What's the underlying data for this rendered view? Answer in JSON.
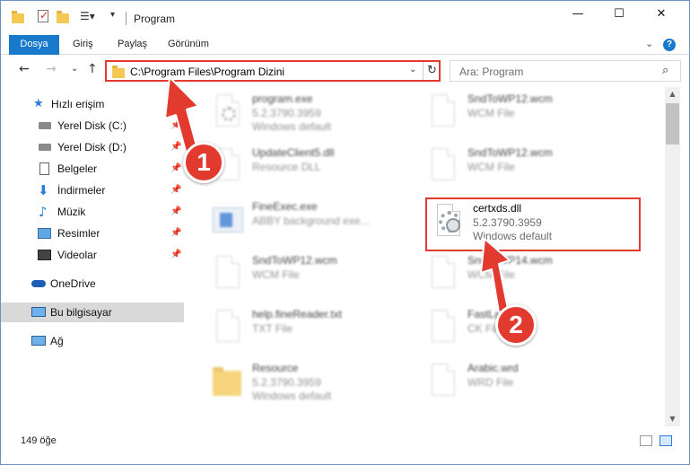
{
  "titlebar": {
    "title": "Program",
    "minimize": "—",
    "maximize": "☐",
    "close": "✕"
  },
  "ribbon": {
    "tabs": [
      "Dosya",
      "Giriş",
      "Paylaş",
      "Görünüm"
    ],
    "help": "?"
  },
  "nav": {
    "back": "←",
    "forward": "→",
    "recent": "⌄",
    "up": "↑",
    "address": "C:\\Program Files\\Program Dizini",
    "refresh": "↻",
    "search_placeholder": "Ara: Program"
  },
  "sidebar": {
    "items": [
      {
        "label": "Hızlı erişim",
        "icon": "star-icon",
        "pinned": false
      },
      {
        "label": "Yerel Disk (C:)",
        "icon": "drive-icon",
        "pinned": true
      },
      {
        "label": "Yerel Disk (D:)",
        "icon": "drive-icon",
        "pinned": true
      },
      {
        "label": "Belgeler",
        "icon": "documents-icon",
        "pinned": true
      },
      {
        "label": "İndirmeler",
        "icon": "download-icon",
        "pinned": true
      },
      {
        "label": "Müzik",
        "icon": "music-icon",
        "pinned": true
      },
      {
        "label": "Resimler",
        "icon": "pictures-icon",
        "pinned": true
      },
      {
        "label": "Videolar",
        "icon": "videos-icon",
        "pinned": true
      },
      {
        "label": "OneDrive",
        "icon": "cloud-icon",
        "pinned": false
      },
      {
        "label": "Bu bilgisayar",
        "icon": "computer-icon",
        "pinned": false,
        "selected": true
      },
      {
        "label": "Ağ",
        "icon": "network-icon",
        "pinned": false
      }
    ],
    "pin_glyph": "📌"
  },
  "files": [
    {
      "name": "program.exe",
      "line2": "5.2.3790.3959",
      "line3": "Windows default",
      "icon": "app-icon"
    },
    {
      "name": "SndToWP12.wcm",
      "line2": "WCM File",
      "line3": "",
      "icon": "file-icon"
    },
    {
      "name": "UpdateClient5.dll",
      "line2": "Resource DLL",
      "line3": "",
      "icon": "file-icon"
    },
    {
      "name": "SndToWP12.wcm",
      "line2": "WCM File",
      "line3": "",
      "icon": "file-icon"
    },
    {
      "name": "FineExec.exe",
      "line2": "ABBY background exe...",
      "line3": "",
      "icon": "exe-icon"
    },
    {
      "name": "certxds.dll",
      "line2": "5.2.3790.3959",
      "line3": "Windows default",
      "icon": "gear-icon"
    },
    {
      "name": "SndToWP12.wcm",
      "line2": "WCM File",
      "line3": "",
      "icon": "file-icon"
    },
    {
      "name": "SndToWP14.wcm",
      "line2": "WCM File",
      "line3": "",
      "icon": "file-icon"
    },
    {
      "name": "help.fineReader.txt",
      "line2": "TXT File",
      "line3": "",
      "icon": "file-icon"
    },
    {
      "name": "FastLabel.ck",
      "line2": "CK File",
      "line3": "",
      "icon": "file-icon"
    },
    {
      "name": "Resource",
      "line2": "5.2.3790.3959",
      "line3": "Windows default",
      "icon": "folder-icon"
    },
    {
      "name": "Arabic.wrd",
      "line2": "WRD File",
      "line3": "",
      "icon": "file-icon"
    }
  ],
  "status": {
    "count": "149 öğe"
  },
  "annotations": {
    "badge1": "1",
    "badge2": "2",
    "accent": "#e23a2e"
  }
}
